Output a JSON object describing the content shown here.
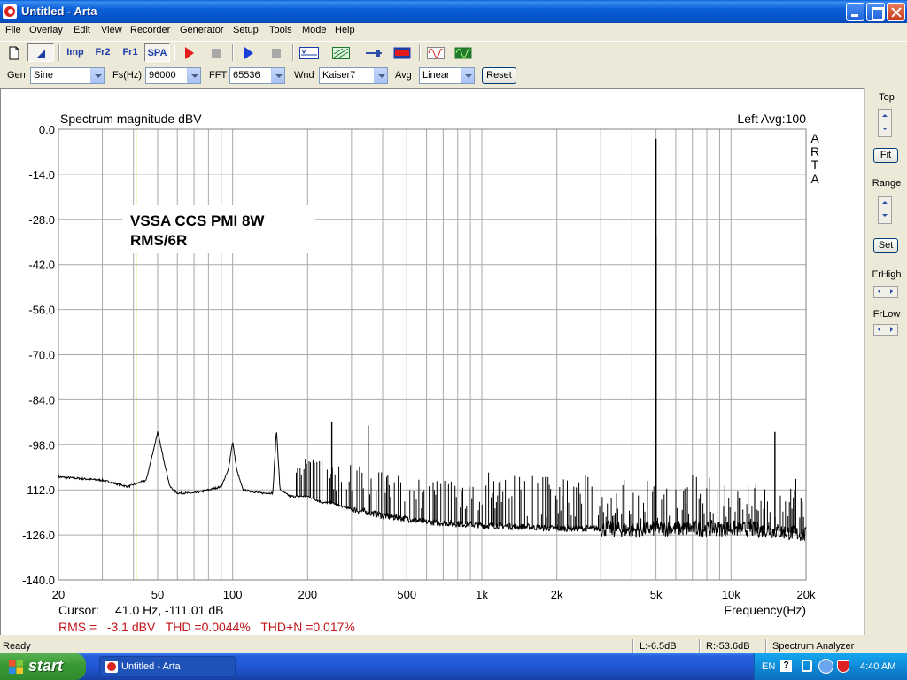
{
  "window": {
    "title": "Untitled - Arta"
  },
  "menu": [
    "File",
    "Overlay",
    "Edit",
    "View",
    "Recorder",
    "Generator",
    "Setup",
    "Tools",
    "Mode",
    "Help"
  ],
  "toolbar": {
    "buttons": [
      {
        "name": "new-document-button",
        "label": "",
        "icon": "new-document-icon"
      },
      {
        "name": "cursor-mode-button",
        "label": "",
        "icon": "cursor-icon"
      },
      {
        "name": "imp-mode-button",
        "label": "Imp"
      },
      {
        "name": "fr2-mode-button",
        "label": "Fr2"
      },
      {
        "name": "fr1-mode-button",
        "label": "Fr1"
      },
      {
        "name": "spa-mode-button",
        "label": "SPA"
      }
    ],
    "colors": {
      "record_red": "#e21b1b",
      "play_blue": "#1b3fd6",
      "mode_blue": "#1c3ca8"
    }
  },
  "params": {
    "gen": {
      "label": "Gen",
      "value": "Sine"
    },
    "fs": {
      "label": "Fs(Hz)",
      "value": "96000"
    },
    "fft": {
      "label": "FFT",
      "value": "65536"
    },
    "wnd": {
      "label": "Wnd",
      "value": "Kaiser7"
    },
    "avg": {
      "label": "Avg",
      "value": "Linear"
    },
    "reset_label": "Reset"
  },
  "chart": {
    "title": "Spectrum magnitude dBV",
    "channel_info": "Left  Avg:100",
    "annotation_line1": "VSSA CCS PMI 8W",
    "annotation_line2": "RMS/6R",
    "watermark": [
      "A",
      "R",
      "T",
      "A"
    ],
    "x_label": "Frequency(Hz)",
    "cursor_label": "Cursor:",
    "cursor_value": "41.0 Hz, -111.01 dB",
    "rms_line": "RMS =   -3.1 dBV   THD =0.0044%   THD+N =0.017%",
    "colors": {
      "grid": "#a9a9a9",
      "trace": "#000000",
      "cursor": "#d9c400",
      "rms_text": "#c0141a"
    }
  },
  "chart_data": {
    "type": "line",
    "title": "Spectrum magnitude dBV",
    "xlabel": "Frequency(Hz)",
    "ylabel": "",
    "x_scale": "log",
    "xlim": [
      20,
      20000
    ],
    "ylim": [
      -140,
      0
    ],
    "x_ticks": [
      20,
      50,
      100,
      200,
      500,
      1000,
      2000,
      5000,
      10000,
      20000
    ],
    "x_tick_labels": [
      "20",
      "50",
      "100",
      "200",
      "500",
      "1k",
      "2k",
      "5k",
      "10k",
      "20k"
    ],
    "y_ticks": [
      0,
      -14,
      -28,
      -42,
      -56,
      -70,
      -84,
      -98,
      -112,
      -126,
      -140
    ],
    "y_tick_labels": [
      "0.0",
      "-14.0",
      "-28.0",
      "-42.0",
      "-56.0",
      "-70.0",
      "-84.0",
      "-98.0",
      "-112.0",
      "-126.0",
      "-140.0"
    ],
    "grid": true,
    "cursor_hz": 41,
    "series": [
      {
        "x": [
          20,
          30,
          38,
          45,
          48,
          50,
          52,
          56,
          60,
          70,
          80,
          90,
          96,
          100,
          104,
          110,
          130,
          145,
          150,
          155,
          170,
          190,
          200,
          230,
          250,
          270,
          300,
          350,
          400,
          500,
          600,
          800,
          1000,
          1500,
          2000,
          3000,
          4000,
          5000,
          6000,
          8000,
          10000,
          14000,
          16000,
          20000
        ],
        "y": [
          -108,
          -109,
          -111,
          -109,
          -100,
          -94,
          -100,
          -111,
          -113,
          -113,
          -112,
          -111,
          -106,
          -97,
          -106,
          -112,
          -113,
          -113,
          -93,
          -112,
          -114,
          -114,
          -114,
          -116,
          -116,
          -117,
          -118,
          -119,
          -120,
          -121,
          -122,
          -122.5,
          -123,
          -123.5,
          -124,
          -124,
          -124.5,
          -124,
          -124,
          -124,
          -124,
          -124.5,
          -125,
          -126
        ]
      }
    ],
    "peaks": [
      {
        "hz": 50,
        "db": -94
      },
      {
        "hz": 100,
        "db": -97
      },
      {
        "hz": 150,
        "db": -93
      },
      {
        "hz": 250,
        "db": -91
      },
      {
        "hz": 350,
        "db": -92
      },
      {
        "hz": 5000,
        "db": -3
      },
      {
        "hz": 5000,
        "db": -33
      },
      {
        "hz": 15000,
        "db": -94
      }
    ]
  },
  "right_panel": {
    "top_label": "Top",
    "fit_label": "Fit",
    "range_label": "Range",
    "set_label": "Set",
    "frhigh_label": "FrHigh",
    "frlow_label": "FrLow"
  },
  "status": {
    "ready": "Ready",
    "left_level": "L:-6.5dB",
    "right_level": "R:-53.6dB",
    "mode": "Spectrum Analyzer"
  },
  "taskbar": {
    "start_label": "start",
    "task_label": "Untitled - Arta",
    "lang": "EN",
    "clock": "4:40 AM",
    "colors": {
      "start_green": "#3a9b36",
      "taskbar_blue": "#245edc"
    }
  }
}
